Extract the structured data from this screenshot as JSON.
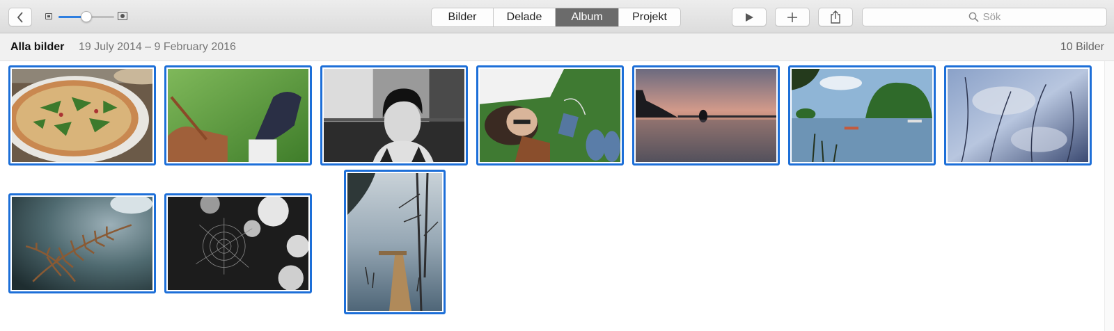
{
  "toolbar": {
    "tabs": [
      {
        "label": "Bilder",
        "active": false
      },
      {
        "label": "Delade",
        "active": false
      },
      {
        "label": "Album",
        "active": true
      },
      {
        "label": "Projekt",
        "active": false
      }
    ],
    "search_placeholder": "Sök",
    "zoom_level": 0.5,
    "icons": {
      "back": "chevron-left-icon",
      "zoom_small": "small-photo-icon",
      "zoom_large": "large-photo-icon",
      "play": "play-icon",
      "add": "plus-icon",
      "share": "share-icon",
      "search": "search-icon"
    }
  },
  "header": {
    "title": "Alla bilder",
    "date_range": "19 July 2014 – 9 February 2016",
    "count": "10 Bilder"
  },
  "colors": {
    "selection": "#1d6fd8",
    "active_tab": "#6b6b6b",
    "slider_fill": "#2f7fe0"
  },
  "photos": [
    {
      "subject": "pizza",
      "selected": true
    },
    {
      "subject": "bag-and-shoe-on-grass",
      "selected": true
    },
    {
      "subject": "woman-portrait-bw",
      "selected": true
    },
    {
      "subject": "woman-lying-on-grass",
      "selected": true
    },
    {
      "subject": "lake-sunset",
      "selected": true
    },
    {
      "subject": "lake-islands",
      "selected": true
    },
    {
      "subject": "water-reflection",
      "selected": true
    },
    {
      "subject": "fern",
      "selected": true
    },
    {
      "subject": "spiderweb-bw",
      "selected": true
    },
    {
      "subject": "jetty-in-lake",
      "selected": true
    }
  ]
}
